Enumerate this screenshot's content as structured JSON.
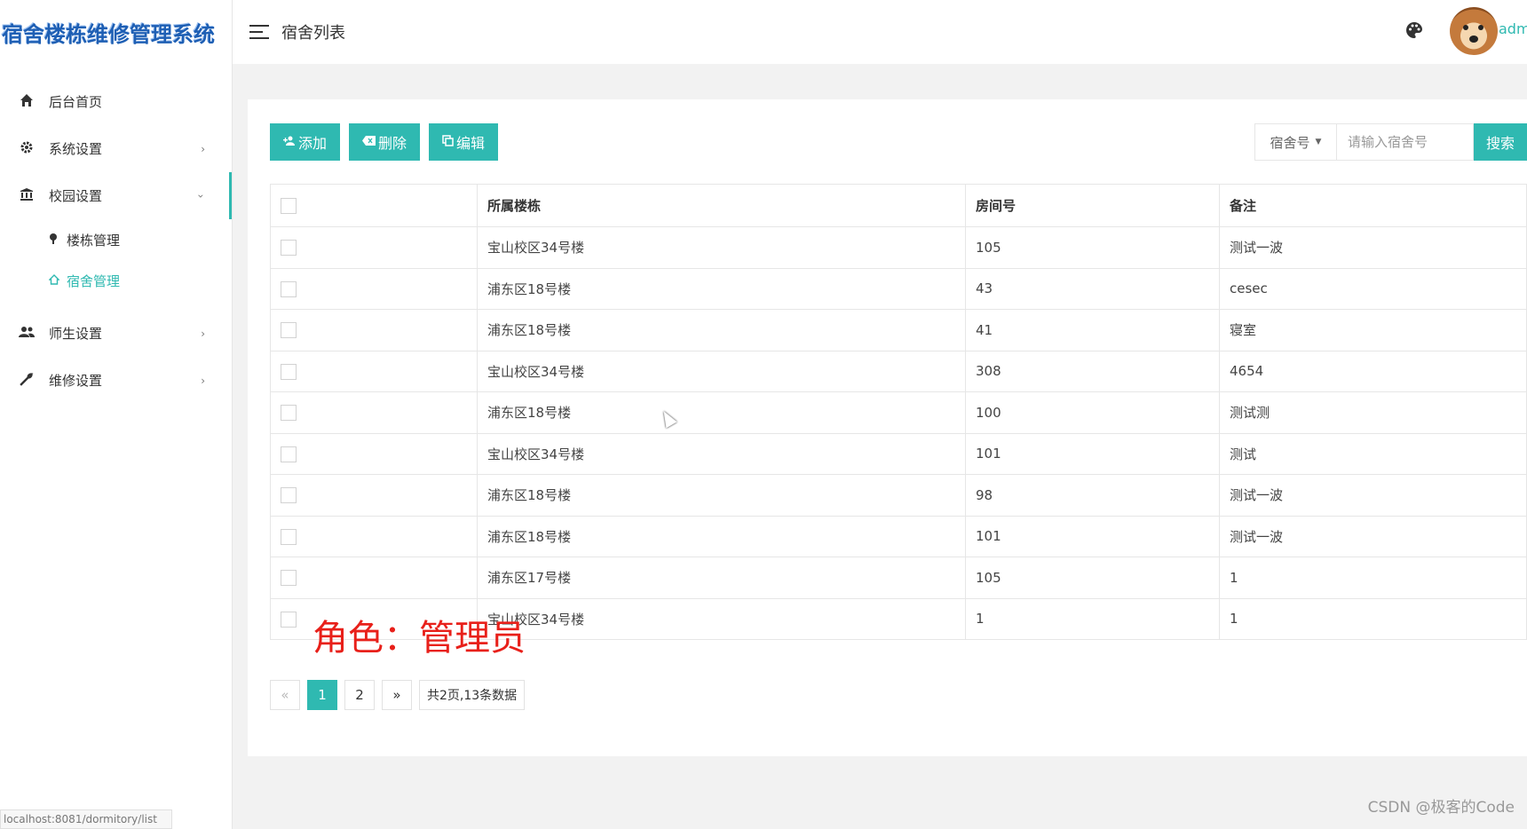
{
  "app": {
    "logo_text": "宿舍楼栋维修管理系统",
    "status_url": "localhost:8081/dormitory/list"
  },
  "sidebar": {
    "items": [
      {
        "label": "后台首页",
        "icon": "home-icon"
      },
      {
        "label": "系统设置",
        "icon": "gear-icon",
        "arrow": "›"
      },
      {
        "label": "校园设置",
        "icon": "institution-icon",
        "arrow": "‹"
      },
      {
        "label": "师生设置",
        "icon": "users-icon",
        "arrow": "›"
      },
      {
        "label": "维修设置",
        "icon": "wrench-icon",
        "arrow": "›"
      }
    ],
    "sub_items": [
      {
        "label": "楼栋管理",
        "icon": "pin-icon"
      },
      {
        "label": "宿舍管理",
        "icon": "house-icon"
      }
    ]
  },
  "header": {
    "title": "宿舍列表",
    "username": "adm"
  },
  "toolbar": {
    "add_label": "添加",
    "delete_label": "删除",
    "edit_label": "编辑"
  },
  "search": {
    "field_label": "宿舍号",
    "placeholder": "请输入宿舍号",
    "button_label": "搜索"
  },
  "table": {
    "columns": [
      "所属楼栋",
      "房间号",
      "备注"
    ],
    "rows": [
      [
        "宝山校区34号楼",
        "105",
        "测试一波"
      ],
      [
        "浦东区18号楼",
        "43",
        "cesec"
      ],
      [
        "浦东区18号楼",
        "41",
        "寝室"
      ],
      [
        "宝山校区34号楼",
        "308",
        "4654"
      ],
      [
        "浦东区18号楼",
        "100",
        "测试测"
      ],
      [
        "宝山校区34号楼",
        "101",
        "测试"
      ],
      [
        "浦东区18号楼",
        "98",
        "测试一波"
      ],
      [
        "浦东区18号楼",
        "101",
        "测试一波"
      ],
      [
        "浦东区17号楼",
        "105",
        "1"
      ],
      [
        "宝山校区34号楼",
        "1",
        "1"
      ]
    ]
  },
  "pagination": {
    "prev": "«",
    "pages": [
      "1",
      "2"
    ],
    "next": "»",
    "info": "共2页,13条数据"
  },
  "overlay": {
    "role_text": "角色：管理员",
    "watermark": "CSDN @极客的Code"
  },
  "colors": {
    "accent": "#2fb9b1",
    "overlay_red": "#e8201a"
  }
}
